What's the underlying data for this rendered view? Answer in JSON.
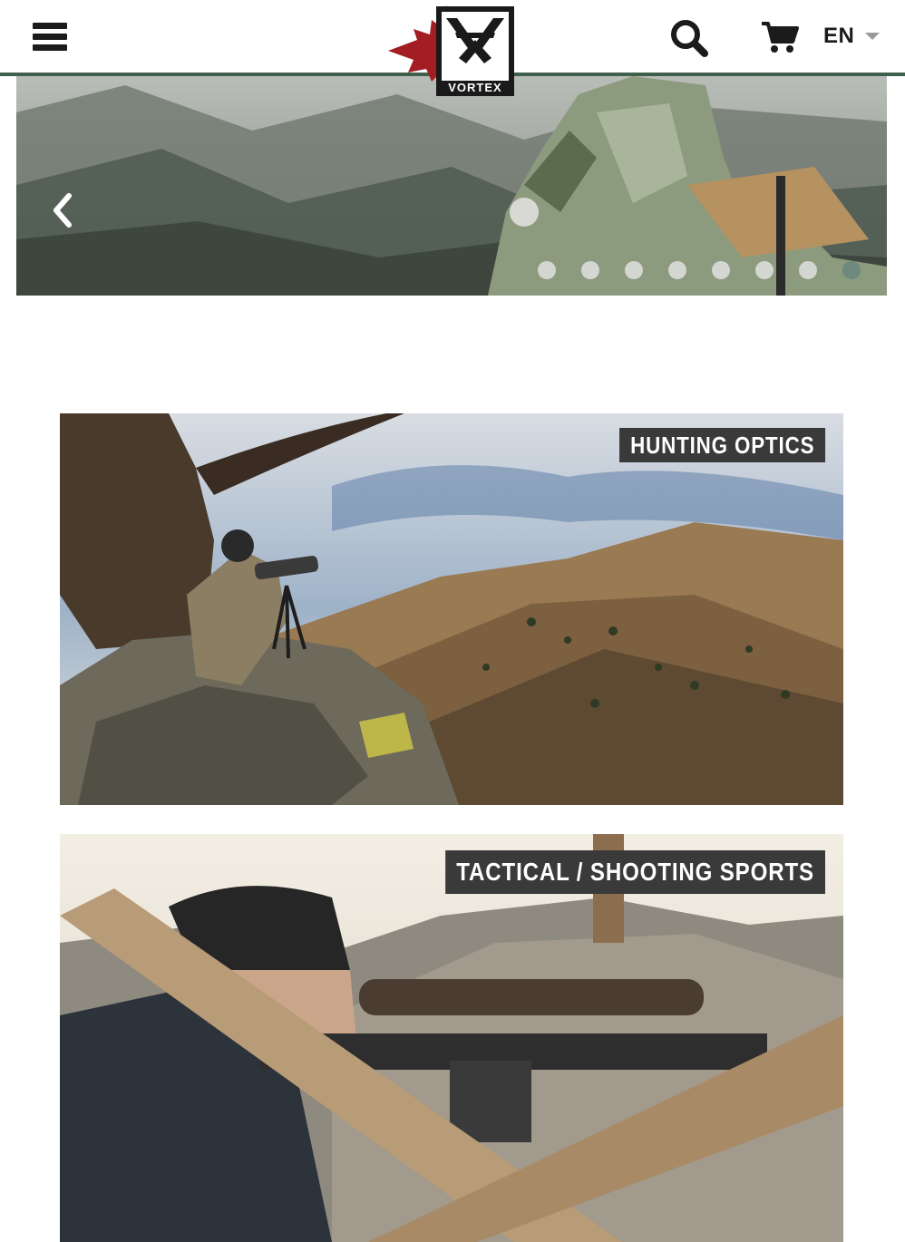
{
  "header": {
    "menu_icon": "hamburger-menu-icon",
    "logo_text": "VORTEX",
    "search_icon": "search-icon",
    "cart_icon": "shopping-cart-icon",
    "language": "EN",
    "language_caret_icon": "caret-down-icon",
    "accent_color": "#3f5f4c"
  },
  "hero": {
    "prev_icon": "chevron-left-icon",
    "slide_count": 8,
    "active_slide": 8,
    "active_dot_color": "#6e8a7c"
  },
  "tiles": [
    {
      "label": "HUNTING OPTICS"
    },
    {
      "label": "TACTICAL / SHOOTING SPORTS"
    }
  ]
}
